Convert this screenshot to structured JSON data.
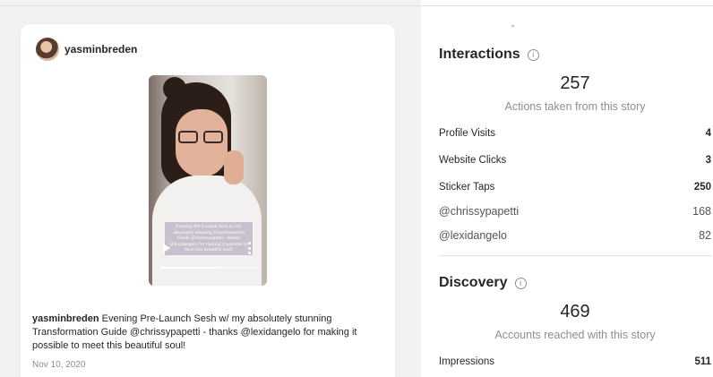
{
  "post": {
    "username": "yasminbreden",
    "caption_user": "yasminbreden",
    "caption_text": " Evening Pre-Launch Sesh w/ my absolutely stunning Transformation Guide @chrissypapetti - thanks @lexidangelo for making it possible to meet this beautiful soul!",
    "date": "Nov 10, 2020",
    "story_overlay_text": "Evening Pre-Launch Sesh w/ my absolutely stunning Transformation Guide @chrissypapetti - thanks @lexidangelo for making it possible to meet this beautiful soul!",
    "video_progress_fraction": 0.6
  },
  "interactions": {
    "title": "Interactions",
    "total": "257",
    "total_label": "Actions taken from this story",
    "rows": [
      {
        "label": "Profile Visits",
        "value": "4"
      },
      {
        "label": "Website Clicks",
        "value": "3"
      },
      {
        "label": "Sticker Taps",
        "value": "250"
      }
    ],
    "sticker_rows": [
      {
        "label": "@chrissypapetti",
        "value": "168"
      },
      {
        "label": "@lexidangelo",
        "value": "82"
      }
    ]
  },
  "discovery": {
    "title": "Discovery",
    "total": "469",
    "total_label": "Accounts reached with this story",
    "rows": [
      {
        "label": "Impressions",
        "value": "511"
      }
    ]
  },
  "icons": {
    "info": "info-icon",
    "play": "play-icon",
    "more": "more-vertical-icon"
  },
  "colors": {
    "left_background": "#f2f2f4",
    "muted_text": "#8e8e8e",
    "primary_text": "#262626"
  }
}
